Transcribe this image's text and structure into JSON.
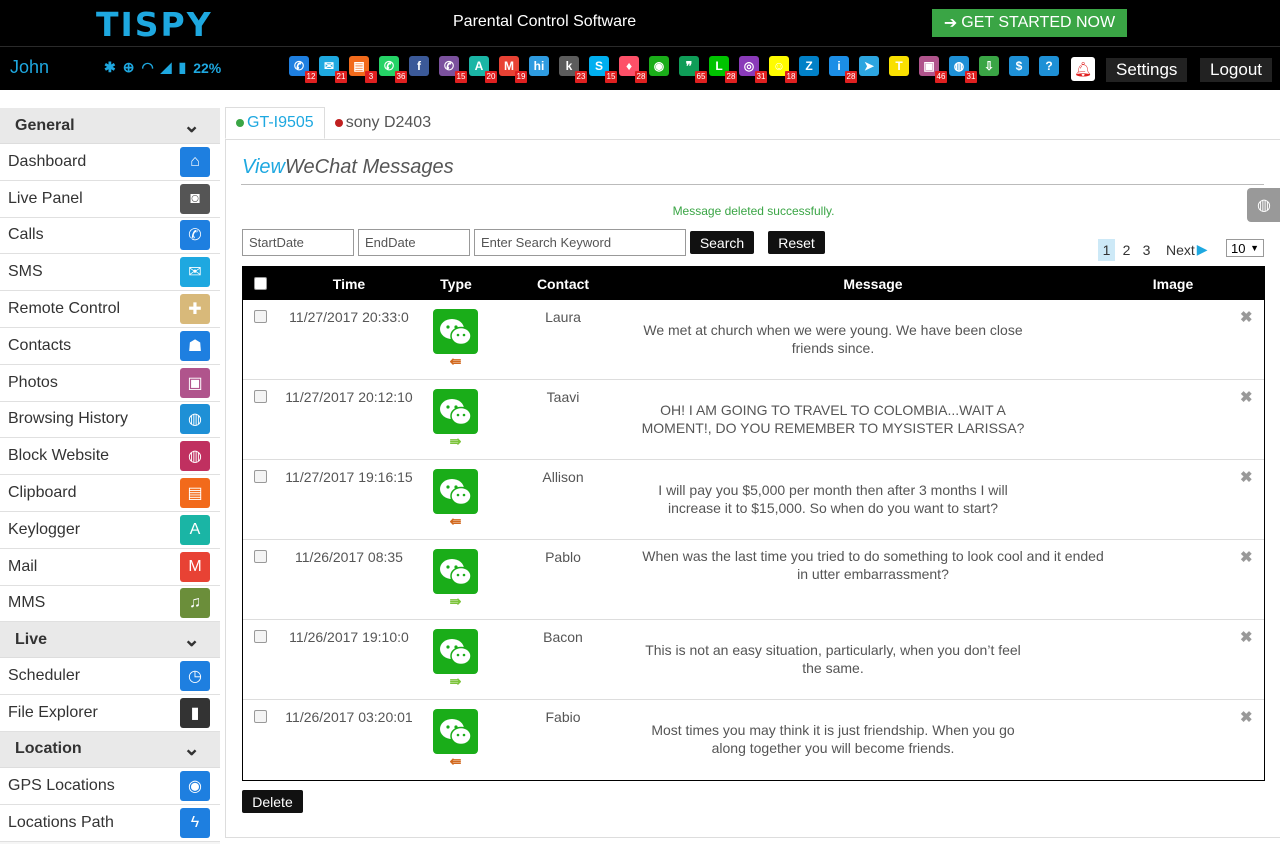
{
  "brand": {
    "logo": "TISPY",
    "tagline": "Parental Control Software",
    "cta": "GET STARTED NOW"
  },
  "user": {
    "name": "John"
  },
  "status": {
    "battery": "22%"
  },
  "apps": [
    {
      "icon": "phone-icon",
      "glyph": "✆",
      "bg": "#1e7fe0",
      "badge": "12"
    },
    {
      "icon": "mail-icon",
      "glyph": "✉",
      "bg": "#1ea8e0",
      "badge": "21"
    },
    {
      "icon": "clipboard-icon",
      "glyph": "▤",
      "bg": "#f26a1b",
      "badge": "3"
    },
    {
      "icon": "whatsapp-icon",
      "glyph": "✆",
      "bg": "#25d366",
      "badge": "36"
    },
    {
      "icon": "facebook-icon",
      "glyph": "f",
      "bg": "#3b5998",
      "badge": ""
    },
    {
      "icon": "viber-icon",
      "glyph": "✆",
      "bg": "#7b519d",
      "badge": "15"
    },
    {
      "icon": "keylogger-icon",
      "glyph": "A",
      "bg": "#1ab5a5",
      "badge": "20"
    },
    {
      "icon": "gmail-icon",
      "glyph": "M",
      "bg": "#e84234",
      "badge": "19"
    },
    {
      "icon": "hike-icon",
      "glyph": "hi",
      "bg": "#2e9be0",
      "badge": ""
    },
    {
      "icon": "kik-icon",
      "glyph": "k",
      "bg": "#5c5c5c",
      "badge": "23"
    },
    {
      "icon": "skype-icon",
      "glyph": "S",
      "bg": "#00aff0",
      "badge": "15"
    },
    {
      "icon": "tinder-icon",
      "glyph": "♦",
      "bg": "#fd5068",
      "badge": "28"
    },
    {
      "icon": "wechat-icon",
      "glyph": "◉",
      "bg": "#1aad19",
      "badge": ""
    },
    {
      "icon": "hangouts-icon",
      "glyph": "❞",
      "bg": "#0f9d58",
      "badge": "65"
    },
    {
      "icon": "line-icon",
      "glyph": "L",
      "bg": "#00c300",
      "badge": "28"
    },
    {
      "icon": "instagram-icon",
      "glyph": "◎",
      "bg": "#8a3ab9",
      "badge": "31"
    },
    {
      "icon": "snapchat-icon",
      "glyph": "☺",
      "bg": "#fffc00",
      "badge": "18"
    },
    {
      "icon": "zalo-icon",
      "glyph": "Z",
      "bg": "#0180c7",
      "badge": ""
    },
    {
      "icon": "imo-icon",
      "glyph": "i",
      "bg": "#1b8ee6",
      "badge": "28"
    },
    {
      "icon": "telegram-icon",
      "glyph": "➤",
      "bg": "#2ca5e0",
      "badge": ""
    },
    {
      "icon": "kakao-icon",
      "glyph": "T",
      "bg": "#f9e000",
      "badge": ""
    },
    {
      "icon": "photos-icon",
      "glyph": "▣",
      "bg": "#b0548c",
      "badge": "46"
    },
    {
      "icon": "browser-icon",
      "glyph": "◍",
      "bg": "#1e90d6",
      "badge": "31"
    },
    {
      "icon": "download-icon",
      "glyph": "⇩",
      "bg": "#3aa545",
      "badge": ""
    },
    {
      "icon": "dollar-icon",
      "glyph": "$",
      "bg": "#1e90d6",
      "badge": ""
    },
    {
      "icon": "help-icon",
      "glyph": "?",
      "bg": "#1e90d6",
      "badge": ""
    }
  ],
  "topnav": {
    "settings": "Settings",
    "logout": "Logout"
  },
  "sidebar": {
    "general_label": "General",
    "general": [
      {
        "label": "Dashboard",
        "icon": "home-icon",
        "glyph": "⌂",
        "bg": "#1e7fe0"
      },
      {
        "label": "Live Panel",
        "icon": "camera-icon",
        "glyph": "◙",
        "bg": "#555"
      },
      {
        "label": "Calls",
        "icon": "phone-icon",
        "glyph": "✆",
        "bg": "#1e7fe0"
      },
      {
        "label": "SMS",
        "icon": "envelope-icon",
        "glyph": "✉",
        "bg": "#1ea8e0"
      },
      {
        "label": "Remote Control",
        "icon": "map-pin-icon",
        "glyph": "✚",
        "bg": "#d8b97a"
      },
      {
        "label": "Contacts",
        "icon": "contact-icon",
        "glyph": "☗",
        "bg": "#1e7fe0"
      },
      {
        "label": "Photos",
        "icon": "photos-icon",
        "glyph": "▣",
        "bg": "#b0548c"
      },
      {
        "label": "Browsing History",
        "icon": "globe-icon",
        "glyph": "◍",
        "bg": "#1e90d6"
      },
      {
        "label": "Block Website",
        "icon": "block-globe-icon",
        "glyph": "◍",
        "bg": "#c03060"
      },
      {
        "label": "Clipboard",
        "icon": "clipboard-icon",
        "glyph": "▤",
        "bg": "#f26a1b"
      },
      {
        "label": "Keylogger",
        "icon": "keyboard-icon",
        "glyph": "A",
        "bg": "#1ab5a5"
      },
      {
        "label": "Mail",
        "icon": "gmail-icon",
        "glyph": "M",
        "bg": "#e84234"
      },
      {
        "label": "MMS",
        "icon": "mms-icon",
        "glyph": "♫",
        "bg": "#6b8e3a"
      }
    ],
    "live_label": "Live",
    "live": [
      {
        "label": "Scheduler",
        "icon": "clock-icon",
        "glyph": "◷",
        "bg": "#1e7fe0"
      },
      {
        "label": "File Explorer",
        "icon": "sdcard-icon",
        "glyph": "▮",
        "bg": "#333"
      }
    ],
    "location_label": "Location",
    "location": [
      {
        "label": "GPS Locations",
        "icon": "location-pin-icon",
        "glyph": "◉",
        "bg": "#1e7fe0"
      },
      {
        "label": "Locations Path",
        "icon": "path-icon",
        "glyph": "ϟ",
        "bg": "#1e7fe0"
      }
    ]
  },
  "devices": [
    {
      "name": "GT-I9505",
      "dot": "#3aa545"
    },
    {
      "name": "sony D2403",
      "dot": "#c02020"
    }
  ],
  "page": {
    "title_prefix": "View",
    "title": "WeChat Messages",
    "flash": "Message deleted successfully."
  },
  "filters": {
    "start_placeholder": "StartDate",
    "end_placeholder": "EndDate",
    "keyword_placeholder": "Enter Search Keyword",
    "search": "Search",
    "reset": "Reset"
  },
  "pagination": {
    "pages": [
      "1",
      "2",
      "3"
    ],
    "current": "1",
    "next": "Next",
    "per_page": "10"
  },
  "table": {
    "headers": {
      "time": "Time",
      "type": "Type",
      "contact": "Contact",
      "message": "Message",
      "image": "Image"
    },
    "rows": [
      {
        "time": "11/27/2017 20:33:0",
        "direction": "incoming",
        "contact": "Laura",
        "message": "We met at church when we were young. We have been close friends since."
      },
      {
        "time": "11/27/2017 20:12:10",
        "direction": "outgoing",
        "contact": "Taavi",
        "message": "OH! I AM GOING TO TRAVEL TO COLOMBIA...WAIT A MOMENT!, DO YOU REMEMBER TO MYSISTER LARISSA?"
      },
      {
        "time": "11/27/2017 19:16:15",
        "direction": "incoming",
        "contact": "Allison",
        "message": "I will pay you $5,000 per month then after 3 months I will increase it to $15,000. So when do you want to start?"
      },
      {
        "time": "11/26/2017 08:35",
        "direction": "outgoing",
        "contact": "Pablo",
        "message": "When was the last time you tried to do something to look cool and it ended in utter embarrassment?"
      },
      {
        "time": "11/26/2017 19:10:0",
        "direction": "outgoing",
        "contact": "Bacon",
        "message": "This is not an easy situation, particularly, when you don’t feel the same."
      },
      {
        "time": "11/26/2017 03:20:01",
        "direction": "incoming",
        "contact": "Fabio",
        "message": "Most times you may think it is just friendship. When you go along together you will become friends."
      }
    ]
  },
  "actions": {
    "delete": "Delete"
  },
  "colors": {
    "accent": "#1ea8e0",
    "success": "#3aa545",
    "wechat": "#1aad19",
    "incoming_arrow": "#d2691e",
    "outgoing_arrow": "#7cc33a"
  }
}
